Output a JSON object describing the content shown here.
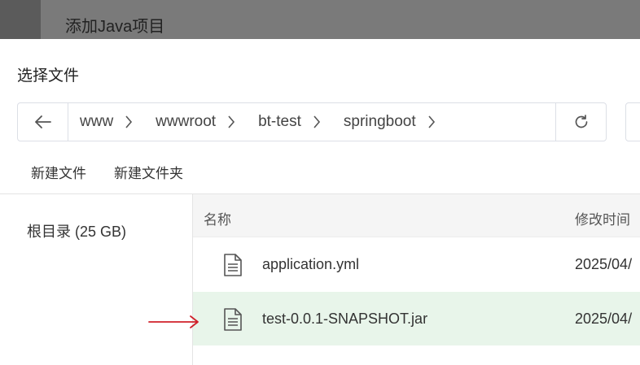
{
  "background": {
    "title": "添加Java项目"
  },
  "dialog": {
    "title": "选择文件",
    "path": [
      "www",
      "wwwroot",
      "bt-test",
      "springboot"
    ],
    "toolbar": {
      "new_file": "新建文件",
      "new_folder": "新建文件夹"
    },
    "tree": {
      "root_label": "根目录 (25 GB)"
    },
    "table": {
      "headers": {
        "name": "名称",
        "modified": "修改时间"
      },
      "rows": [
        {
          "name": "application.yml",
          "modified": "2025/04/",
          "selected": false
        },
        {
          "name": "test-0.0.1-SNAPSHOT.jar",
          "modified": "2025/04/",
          "selected": true
        }
      ]
    }
  },
  "colors": {
    "selected_row": "#e8f5ea",
    "arrow": "#d0202a",
    "border": "#dcdfe6"
  }
}
